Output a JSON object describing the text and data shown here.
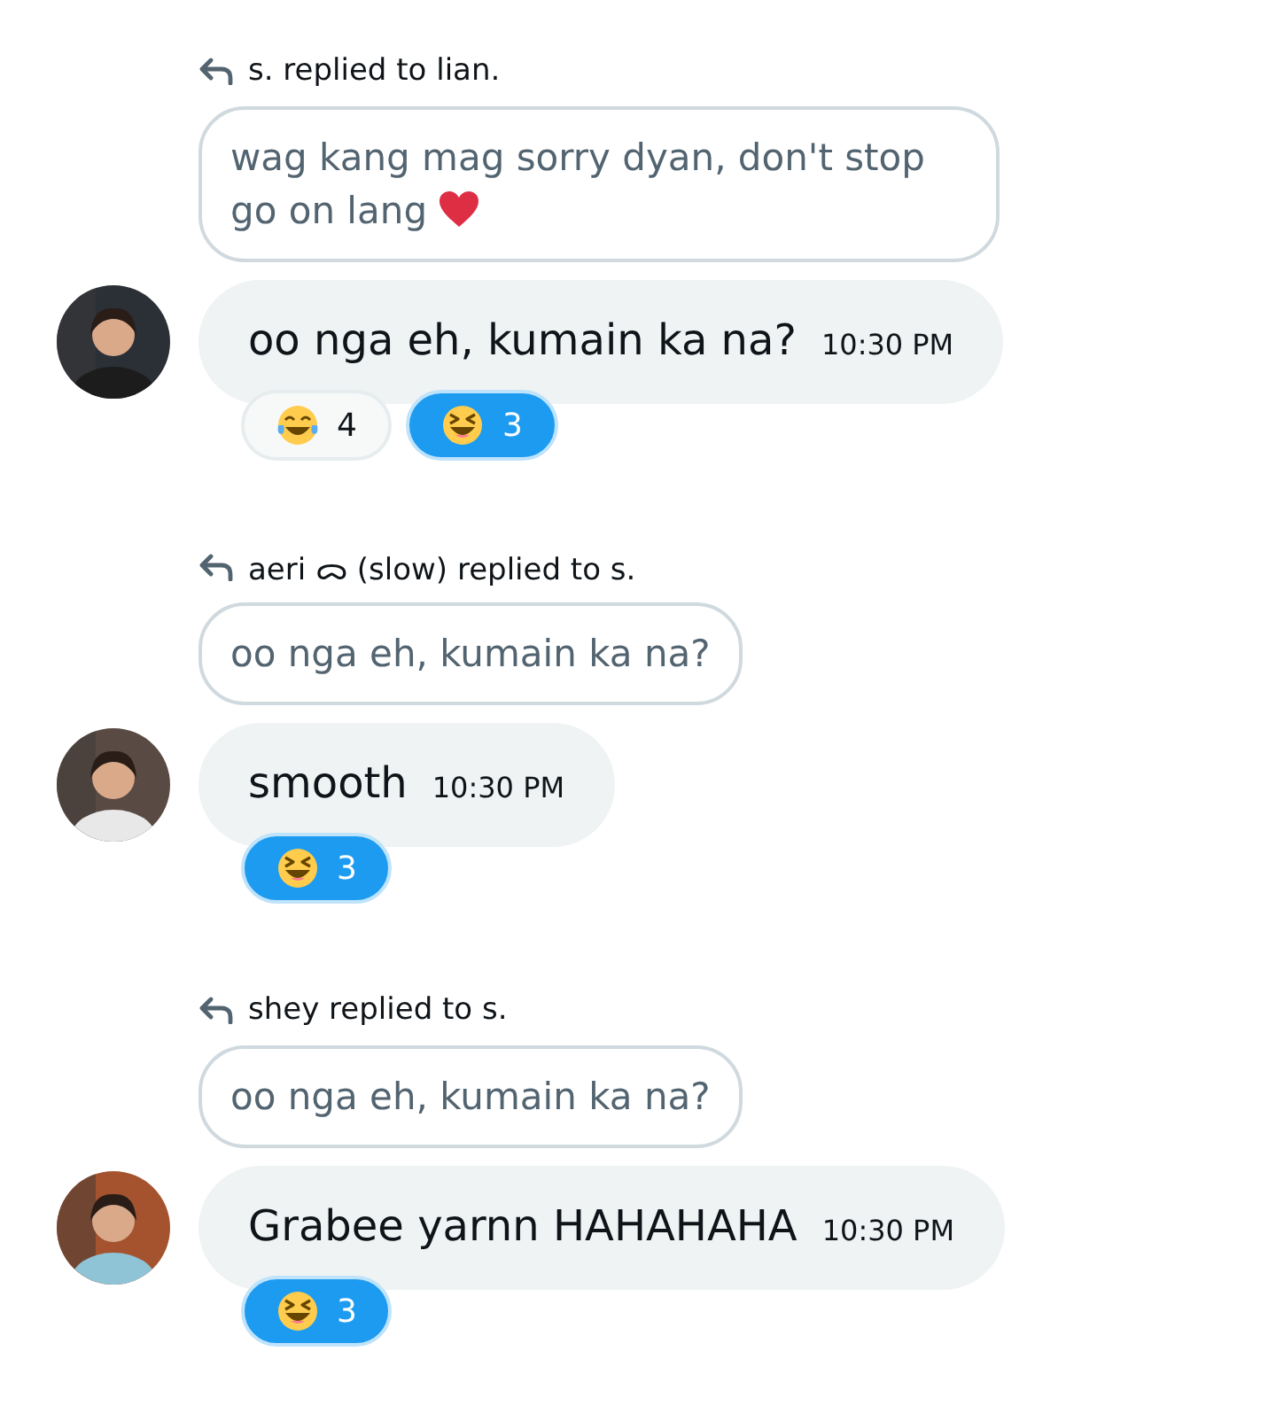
{
  "messages": [
    {
      "reply_header": "s. replied to lian.",
      "quote": {
        "kind": "with-heart",
        "text": "wag kang mag sorry dyan, don't stop go on lang"
      },
      "text": "oo nga eh, kumain ka na?",
      "time": "10:30 PM",
      "reactions": [
        {
          "kind": "tears-of-joy",
          "count": "4",
          "selected": false
        },
        {
          "kind": "squint-laugh",
          "count": "3",
          "selected": true
        }
      ]
    },
    {
      "reply_header": "aeri ᯅ (slow) replied to s.",
      "quote": {
        "kind": "plain",
        "text": "oo nga eh, kumain ka na?"
      },
      "text": "smooth",
      "time": "10:30 PM",
      "reactions": [
        {
          "kind": "squint-laugh",
          "count": "3",
          "selected": true
        }
      ]
    },
    {
      "reply_header": "shey replied to s.",
      "quote": {
        "kind": "plain",
        "text": "oo nga eh, kumain ka na?"
      },
      "text": "Grabee yarnn HAHAHAHA",
      "time": "10:30 PM",
      "reactions": [
        {
          "kind": "squint-laugh",
          "count": "3",
          "selected": true
        }
      ]
    }
  ]
}
